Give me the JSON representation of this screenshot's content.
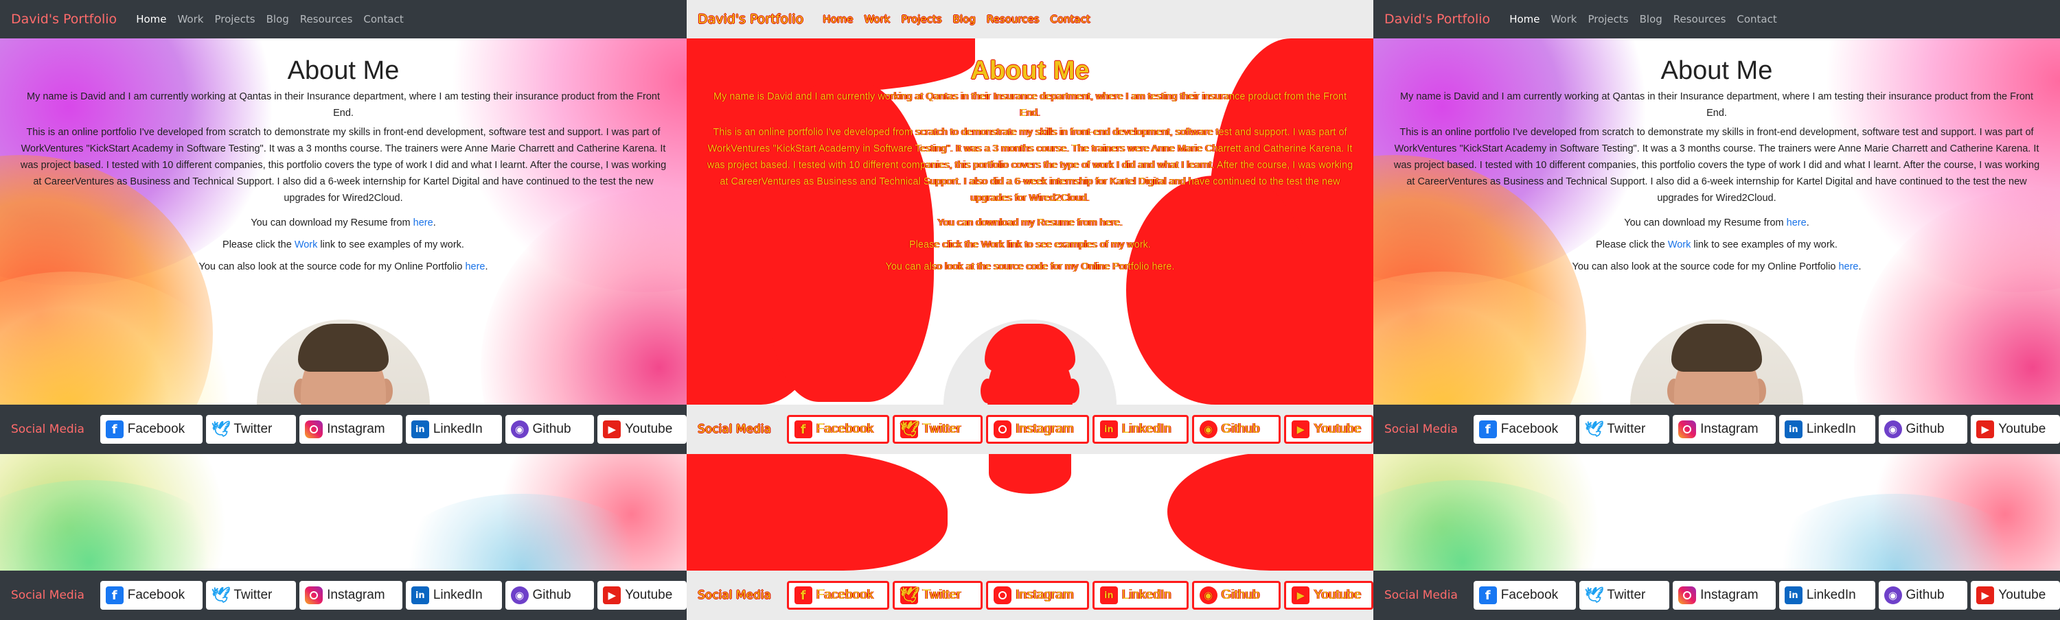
{
  "nav": {
    "brand": "David's Portfolio",
    "links": [
      "Home",
      "Work",
      "Projects",
      "Blog",
      "Resources",
      "Contact"
    ],
    "active": "Home"
  },
  "about": {
    "title": "About Me",
    "para1": "My name is David and I am currently working at Qantas in their Insurance department, where I am testing their insurance product from the Front End.",
    "para2": "This is an online portfolio I've developed from scratch to demonstrate my skills in front-end development, software test and support. I was part of WorkVentures \"KickStart Academy in Software Testing\". It was a 3 months course. The trainers were Anne Marie Charrett and Catherine Karena. It was project based. I tested with 10 different companies, this portfolio covers the type of work I did and what I learnt. After the course, I was working at CareerVentures as Business and Technical Support. I also did a 6-week internship for Kartel Digital and have continued to the test the new upgrades for Wired2Cloud.",
    "resume_pre": "You can download my Resume from ",
    "resume_link": "here",
    "resume_post": ".",
    "work_pre": "Please click the ",
    "work_link": "Work",
    "work_post": " link to see examples of my work.",
    "source_pre": "You can also look at the source code for my Online Portfolio ",
    "source_link": "here",
    "source_post": "."
  },
  "social": {
    "label": "Social Media",
    "items": [
      {
        "label": "Facebook",
        "icon": "facebook-icon"
      },
      {
        "label": "Twitter",
        "icon": "twitter-icon"
      },
      {
        "label": "Instagram",
        "icon": "instagram-icon"
      },
      {
        "label": "LinkedIn",
        "icon": "linkedin-icon"
      },
      {
        "label": "Github",
        "icon": "github-icon"
      },
      {
        "label": "Youtube",
        "icon": "youtube-icon"
      }
    ]
  },
  "colors": {
    "navbar": "#343a40",
    "brand": "#ff6b6b",
    "link": "#1a73e8",
    "diff_red": "#ff1a1a",
    "diff_yellow": "#f0c419"
  }
}
